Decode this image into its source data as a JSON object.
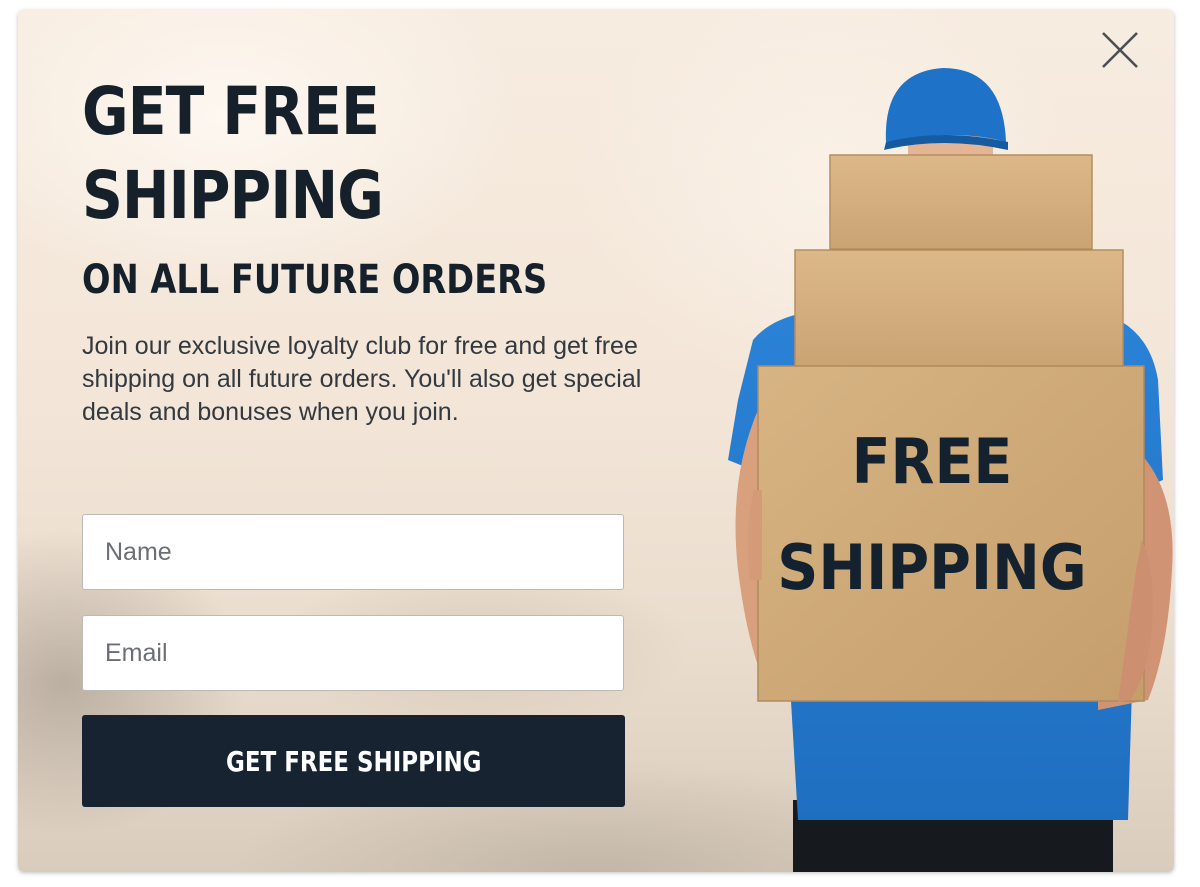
{
  "popup": {
    "headline": "GET FREE SHIPPING",
    "subheadline": "ON ALL FUTURE ORDERS",
    "description": "Join our exclusive loyalty club for free and get free shipping on all future orders. You'll also get special deals and bonuses when you join.",
    "name_placeholder": "Name",
    "email_placeholder": "Email",
    "submit_label": "GET FREE SHIPPING",
    "box_text_line1": "FREE",
    "box_text_line2": "SHIPPING"
  },
  "colors": {
    "navy": "#172331",
    "shirt_blue": "#1f73c9",
    "box_cardboard": "#d2ad7b",
    "background_cream": "#f5e9dc"
  },
  "icons": {
    "close": "close-icon"
  }
}
